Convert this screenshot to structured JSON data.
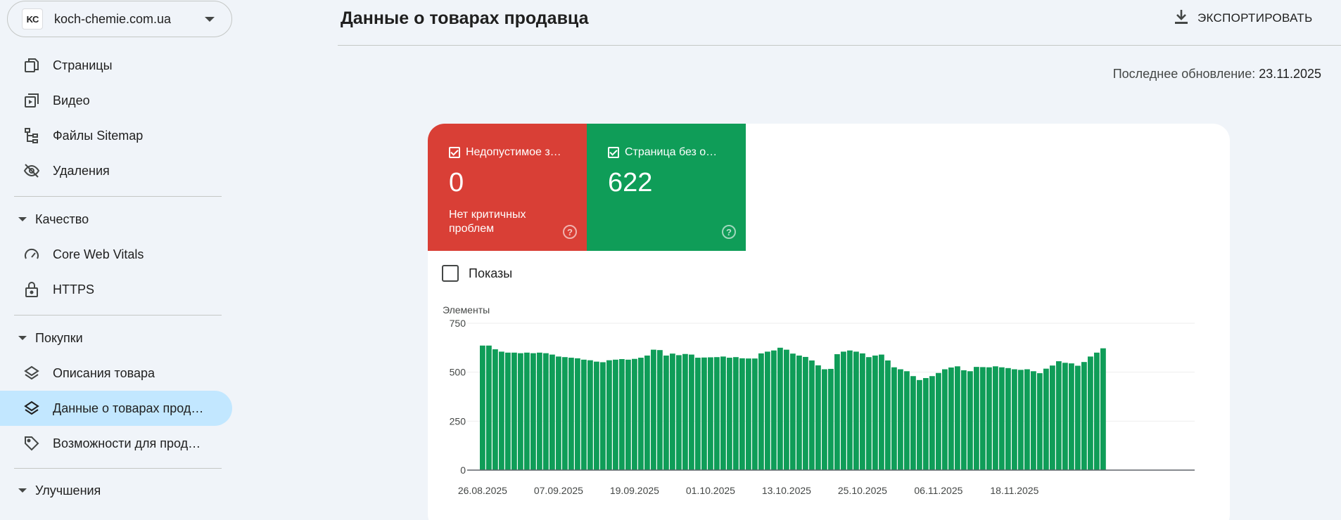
{
  "site": {
    "logo": "KC",
    "name": "koch-chemie.com.ua"
  },
  "nav": {
    "top_items": [
      {
        "label": "Страницы",
        "icon": "pages-icon"
      },
      {
        "label": "Видео",
        "icon": "video-icon"
      },
      {
        "label": "Файлы Sitemap",
        "icon": "sitemap-icon"
      },
      {
        "label": "Удаления",
        "icon": "removals-icon"
      }
    ],
    "quality": {
      "label": "Качество",
      "items": [
        {
          "label": "Core Web Vitals",
          "icon": "gauge-icon"
        },
        {
          "label": "HTTPS",
          "icon": "lock-icon"
        }
      ]
    },
    "shopping": {
      "label": "Покупки",
      "items": [
        {
          "label": "Описания товара",
          "icon": "layers-icon"
        },
        {
          "label": "Данные о товарах прод…",
          "icon": "layers-icon",
          "active": true
        },
        {
          "label": "Возможности для прод…",
          "icon": "tag-icon"
        }
      ]
    },
    "enhancements": {
      "label": "Улучшения"
    }
  },
  "header": {
    "title": "Данные о товарах продавца",
    "export_label": "ЭКСПОРТИРОВАТЬ",
    "last_update_label": "Последнее обновление:",
    "last_update_value": "23.11.2025"
  },
  "tiles": {
    "error": {
      "title": "Недопустимое з…",
      "value": "0",
      "desc": "Нет критичных проблем",
      "color": "#d93f36"
    },
    "valid": {
      "title": "Страница без ош…",
      "value": "622",
      "color": "#0f9d58"
    }
  },
  "impressions": {
    "label": "Показы",
    "checked": false
  },
  "chart_data": {
    "type": "bar",
    "ylabel": "Элементы",
    "ylim": [
      0,
      750
    ],
    "yticks": [
      0,
      250,
      500,
      750
    ],
    "xticks": [
      "26.08.2025",
      "07.09.2025",
      "19.09.2025",
      "01.10.2025",
      "13.10.2025",
      "25.10.2025",
      "06.11.2025",
      "18.11.2025"
    ],
    "bar_color": "#0f9d58",
    "values": [
      636,
      636,
      617,
      605,
      600,
      600,
      597,
      600,
      597,
      600,
      597,
      590,
      580,
      577,
      574,
      571,
      564,
      561,
      554,
      551,
      561,
      564,
      567,
      564,
      568,
      574,
      585,
      615,
      613,
      585,
      595,
      587,
      593,
      590,
      574,
      575,
      576,
      577,
      580,
      574,
      577,
      571,
      570,
      570,
      596,
      605,
      611,
      625,
      615,
      595,
      585,
      578,
      560,
      535,
      515,
      517,
      592,
      605,
      611,
      605,
      596,
      577,
      585,
      590,
      560,
      525,
      515,
      505,
      480,
      460,
      470,
      480,
      496,
      515,
      524,
      530,
      510,
      505,
      527,
      526,
      525,
      530,
      525,
      521,
      515,
      512,
      515,
      505,
      495,
      518,
      534,
      556,
      548,
      545,
      533,
      552,
      580,
      600,
      622
    ]
  }
}
